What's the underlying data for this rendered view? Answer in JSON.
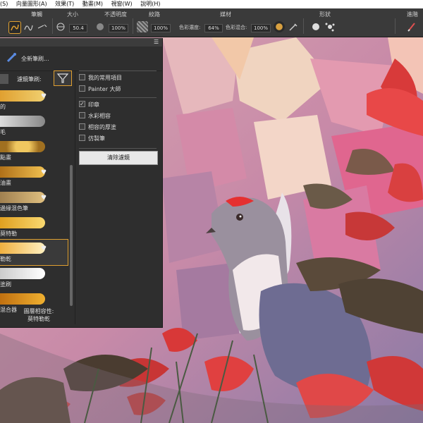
{
  "menu": [
    "(S)",
    "向量圖形(A)",
    "效果(T)",
    "動畫(M)",
    "視窗(W)",
    "說明(H)"
  ],
  "toolbar": {
    "labels": {
      "brush": "筆觸",
      "size": "大小",
      "opacity": "不透明度",
      "texture": "紋路",
      "media": "媒材",
      "shape": "形狀",
      "advanced": "進階"
    },
    "size_value": "50.4",
    "opacity_value": "100%",
    "texture_value": "100%",
    "texture_value2": "100%",
    "color_density_label": "色彩濃度:",
    "color_density_value": "64%",
    "color_blend_label": "色彩混合:",
    "color_blend_value": "100%"
  },
  "panel": {
    "new_brush": "全新筆刷...",
    "filter_label": "濾鏡筆刷:",
    "brushes": [
      {
        "name": "的",
        "color": "#e0a030",
        "heart": true
      },
      {
        "name": "毛",
        "color": "#c0c0c0",
        "heart": false
      },
      {
        "name": "點畫",
        "color": "#e8b840",
        "heart": false
      },
      {
        "name": "油畫",
        "color": "#d8a030",
        "heart": true
      },
      {
        "name": "邊緣混色筆",
        "color": "#d0b060",
        "heart": true
      },
      {
        "name": "莫特勒",
        "color": "#e0a020",
        "heart": false
      },
      {
        "name": "勒乾",
        "color": "#f0c060",
        "heart": true
      },
      {
        "name": "塗刷",
        "color": "#eeeeee",
        "heart": false
      },
      {
        "name": "混合器",
        "color": "#d89020",
        "heart": false
      }
    ],
    "compat_label": "圖層相容性:",
    "compat_value": "莫特勒乾",
    "filters": [
      {
        "label": "我的常用項目",
        "checked": false
      },
      {
        "label": "Painter 大師",
        "checked": false
      },
      {
        "label": "印章",
        "checked": true
      },
      {
        "label": "水彩相容",
        "checked": false
      },
      {
        "label": "相容的厚塗",
        "checked": false
      },
      {
        "label": "仿製筆",
        "checked": false
      }
    ],
    "clear_filter": "清除濾鏡"
  }
}
